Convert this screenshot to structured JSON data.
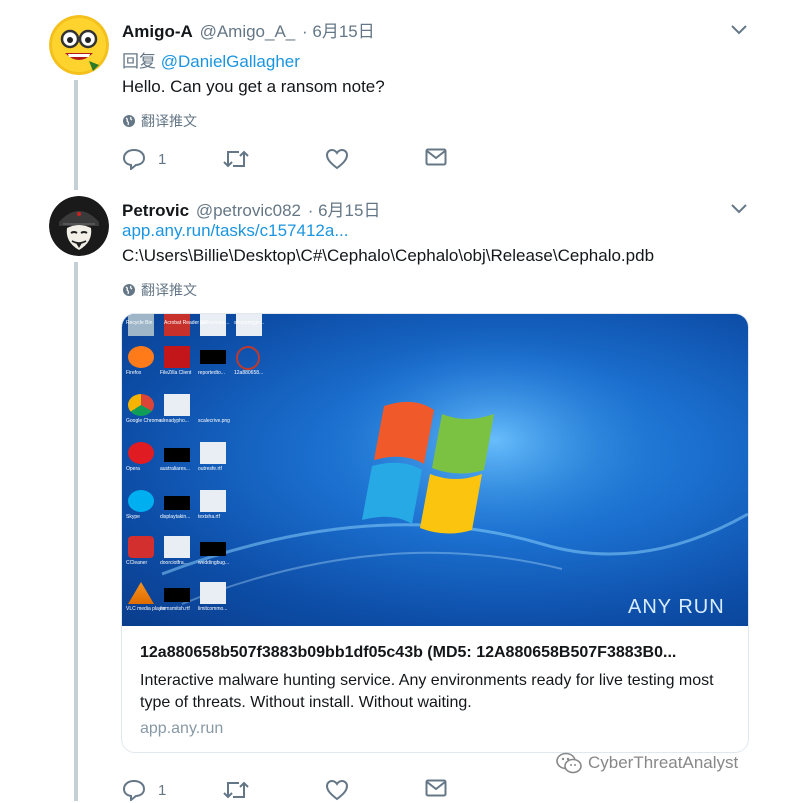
{
  "tweets": [
    {
      "name": "Amigo-A",
      "handle": "@Amigo_A_",
      "date": "· 6月15日",
      "reply_prefix": "回复",
      "reply_to": "@DanielGallagher",
      "text": "Hello. Can you get a ransom note?",
      "translate": "翻译推文",
      "reply_count": "1"
    },
    {
      "name": "Petrovic",
      "handle": "@petrovic082",
      "date": "· 6月15日",
      "link": "app.any.run/tasks/c157412a...",
      "path": "C:\\Users\\Billie\\Desktop\\C#\\Cephalo\\Cephalo\\obj\\Release\\Cephalo.pdb",
      "translate": "翻译推文",
      "reply_count": "1",
      "card": {
        "title": "12a880658b507f3883b09bb1df05c43b (MD5: 12A880658B507F3883B0...",
        "description": "Interactive malware hunting service. Any environments ready for live testing most type of threats. Without install. Without waiting.",
        "domain": "app.any.run",
        "image_brand": "ANY RUN",
        "desktop_icons": [
          "Recycle Bin",
          "Acrobat Reader DC",
          "performanc...",
          "shoppinggo...",
          "Firefox",
          "FileZilla Client",
          "reportedto...",
          "12a880658...",
          "Google Chrome",
          "alreadypho...",
          "scalecrive.png",
          "Opera",
          "australiares...",
          "outresfe.rtf",
          "Skype",
          "displaytakin...",
          "textsha.rtf",
          "CCleaner",
          "doorciotfra...",
          "weddingbug...",
          "VLC media player",
          "itemsmitsh.rtf",
          "limitcommo..."
        ]
      }
    }
  ],
  "watermark": "CyberThreatAnalyst",
  "colors": {
    "link": "#1b95e0",
    "muted": "#657786",
    "thread": "#c4cfd6"
  }
}
